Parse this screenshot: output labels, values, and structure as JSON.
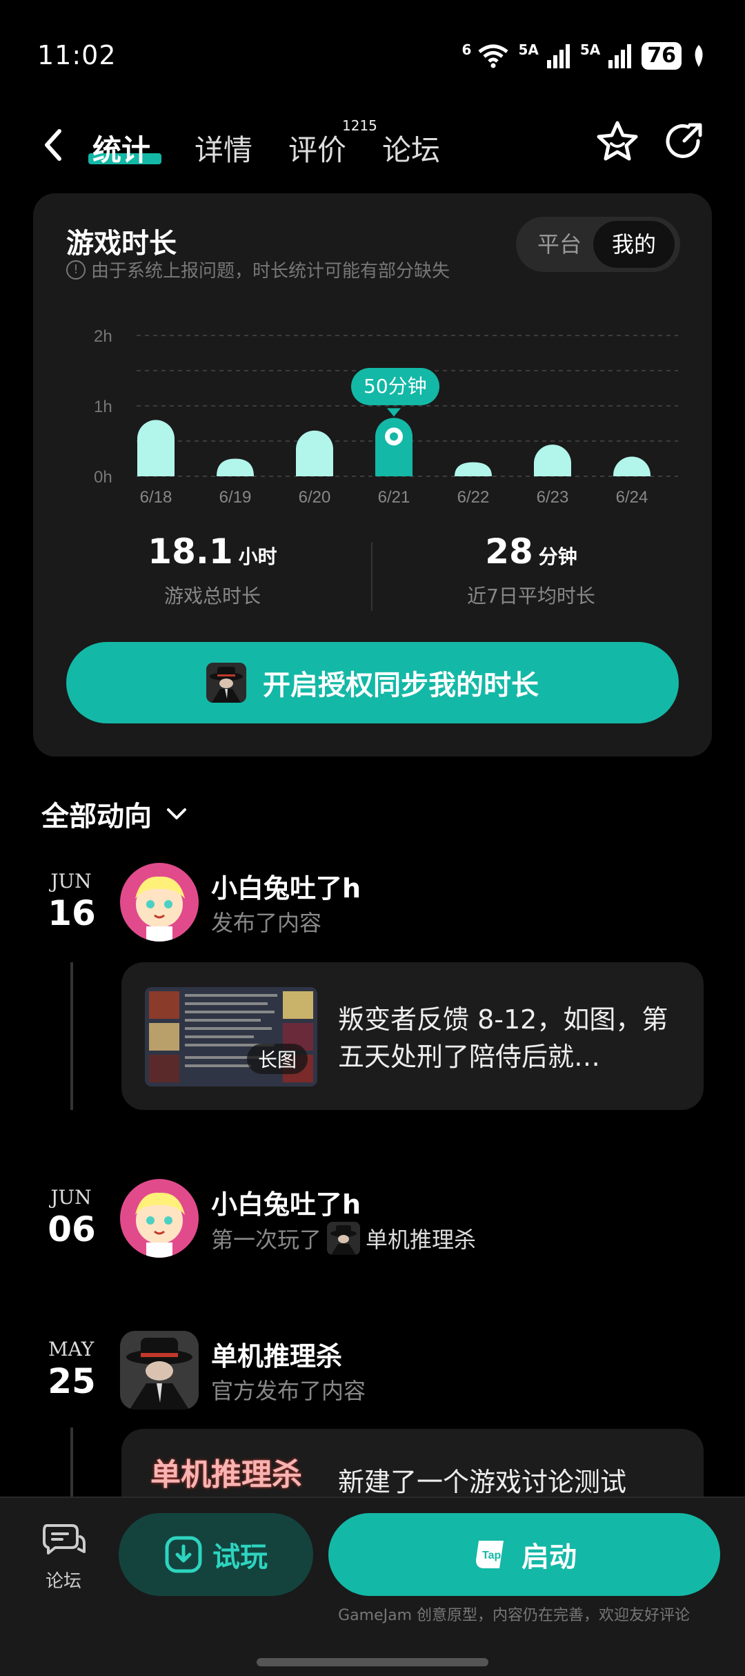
{
  "status": {
    "time": "11:02",
    "wifi_label": "6",
    "sig1_label": "5A",
    "sig2_label": "5A",
    "battery": "76"
  },
  "nav": {
    "tabs": [
      {
        "label": "统计"
      },
      {
        "label": "详情"
      },
      {
        "label": "评价"
      },
      {
        "label": "论坛"
      }
    ],
    "review_count": "1215"
  },
  "playtime": {
    "title": "游戏时长",
    "note": "由于系统上报问题，时长统计可能有部分缺失",
    "toggle": {
      "platform": "平台",
      "mine": "我的"
    },
    "tooltip": "50分钟",
    "total": {
      "value": "18.1",
      "unit": "小时",
      "label": "游戏总时长"
    },
    "average": {
      "value": "28",
      "unit": "分钟",
      "label": "近7日平均时长"
    },
    "sync_button": "开启授权同步我的时长"
  },
  "chart_data": {
    "type": "bar",
    "categories": [
      "6/18",
      "6/19",
      "6/20",
      "6/21",
      "6/22",
      "6/23",
      "6/24"
    ],
    "values": [
      0.8,
      0.25,
      0.65,
      0.83,
      0.2,
      0.45,
      0.28
    ],
    "value_unit": "h",
    "y_ticks": [
      "0h",
      "1h",
      "2h"
    ],
    "ylim": [
      0,
      2
    ],
    "highlight_index": 3,
    "colors": {
      "bar": "#b2f5ea",
      "highlight": "#14b8a6"
    }
  },
  "feed": {
    "header": "全部动向",
    "items": [
      {
        "month": "JUN",
        "day": "16",
        "name": "小白兔吐了h",
        "action": "发布了内容",
        "thumb_tag": "长图",
        "post_text": "叛变者反馈 8-12，如图，第五天处刑了陪侍后就…"
      },
      {
        "month": "JUN",
        "day": "06",
        "name": "小白兔吐了h",
        "action": "第一次玩了",
        "game": "单机推理杀"
      },
      {
        "month": "MAY",
        "day": "25",
        "name": "单机推理杀",
        "action": "官方发布了内容",
        "thumb_title": "单机推理杀",
        "post_text": "新建了一个游戏讨论测试"
      }
    ]
  },
  "bottom": {
    "forum": "论坛",
    "try": "试玩",
    "launch": "启动",
    "tap_logo": "Tap",
    "note": "GameJam 创意原型，内容仍在完善，欢迎友好评论"
  }
}
